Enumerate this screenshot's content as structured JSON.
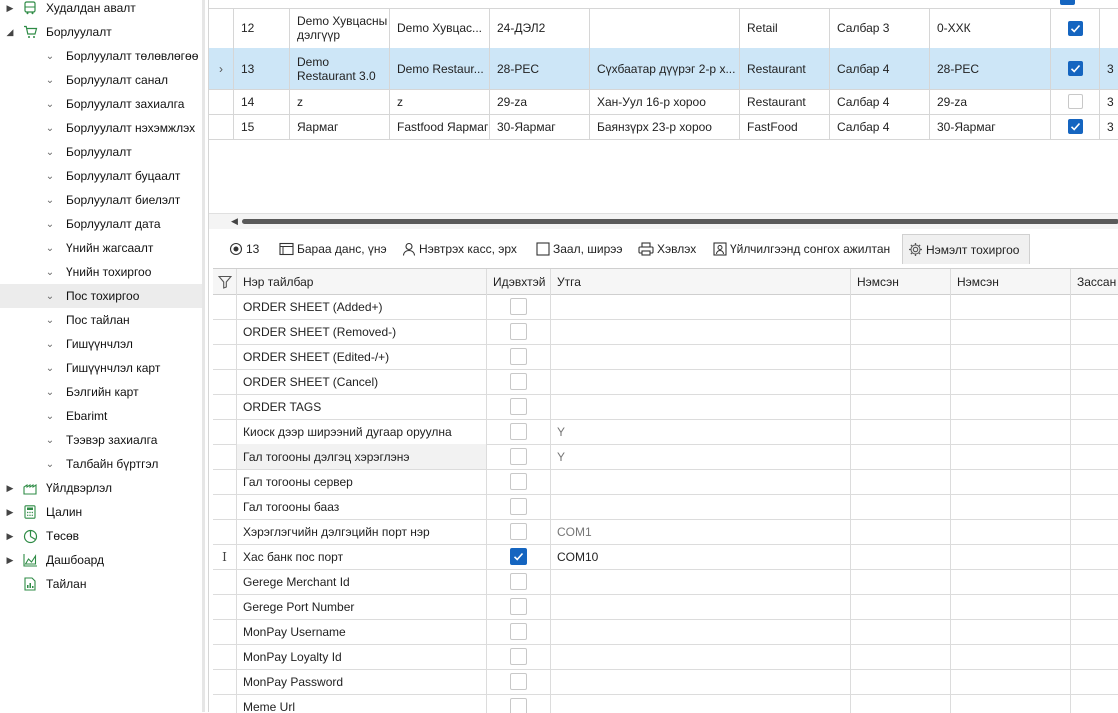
{
  "sidebar": {
    "items": [
      {
        "label": "Худалдан авалт",
        "level": 0,
        "expander": "▶",
        "icon": "bus-icon"
      },
      {
        "label": "Борлуулалт",
        "level": 0,
        "expander": "◢",
        "icon": "cart-icon"
      },
      {
        "label": "Борлуулалт төлөвлөгөө",
        "level": 1
      },
      {
        "label": "Борлуулалт санал",
        "level": 1
      },
      {
        "label": "Борлуулалт захиалга",
        "level": 1
      },
      {
        "label": "Борлуулалт нэхэмжлэх",
        "level": 1
      },
      {
        "label": "Борлуулалт",
        "level": 1
      },
      {
        "label": "Борлуулалт буцаалт",
        "level": 1
      },
      {
        "label": "Борлуулалт биелэлт",
        "level": 1
      },
      {
        "label": "Борлуулалт дата",
        "level": 1
      },
      {
        "label": "Үнийн жагсаалт",
        "level": 1
      },
      {
        "label": "Үнийн тохиргоо",
        "level": 1
      },
      {
        "label": "Пос тохиргоо",
        "level": 1,
        "selected": true
      },
      {
        "label": "Пос тайлан",
        "level": 1
      },
      {
        "label": "Гишүүнчлэл",
        "level": 1
      },
      {
        "label": "Гишүүнчлэл карт",
        "level": 1
      },
      {
        "label": "Бэлгийн карт",
        "level": 1
      },
      {
        "label": "Ebarimt",
        "level": 1
      },
      {
        "label": "Тээвэр захиалга",
        "level": 1
      },
      {
        "label": "Талбайн бүртгэл",
        "level": 1
      },
      {
        "label": "Үйлдвэрлэл",
        "level": 0,
        "expander": "▶",
        "icon": "factory-icon"
      },
      {
        "label": "Цалин",
        "level": 0,
        "expander": "▶",
        "icon": "calculator-icon"
      },
      {
        "label": "Төсөв",
        "level": 0,
        "expander": "▶",
        "icon": "pie-chart-icon"
      },
      {
        "label": "Дашбоард",
        "level": 0,
        "expander": "▶",
        "icon": "area-chart-icon"
      },
      {
        "label": "Тайлан",
        "level": 0,
        "expander": "",
        "icon": "report-icon"
      }
    ]
  },
  "top_grid": {
    "rows": [
      {
        "id": "12",
        "name": "Demo Хувцасны дэлгүүр",
        "short": "Demo Хувцас...",
        "code": "24-ДЭЛ2",
        "address": "",
        "type": "Retail",
        "branch": "Салбар 3",
        "code2": "0-ХХК",
        "active": true,
        "extra": "",
        "selected": false
      },
      {
        "id": "13",
        "name": "Demo Restaurant 3.0",
        "short": "Demo Restaur...",
        "code": "28-PEC",
        "address": "Сүхбаатар дүүрэг 2-р х...",
        "type": "Restaurant",
        "branch": "Салбар 4",
        "code2": "28-PEC",
        "active": true,
        "extra": "3",
        "selected": true
      },
      {
        "id": "14",
        "name": "z",
        "short": "z",
        "code": "29-za",
        "address": "Хан-Уул 16-р хороо",
        "type": "Restaurant",
        "branch": "Салбар 4",
        "code2": "29-za",
        "active": false,
        "extra": "3",
        "selected": false
      },
      {
        "id": "15",
        "name": "Яармаг",
        "short": "Fastfood Яармаг",
        "code": "30-Яармаг",
        "address": "Баянзүрх 23-р хороо",
        "type": "FastFood",
        "branch": "Салбар 4",
        "code2": "30-Яармаг",
        "active": true,
        "extra": "3",
        "selected": false
      }
    ],
    "row_indicator": "›"
  },
  "tabs": [
    {
      "label": "13",
      "icon": "radio-icon",
      "active": false
    },
    {
      "label": "Бараа данс, үнэ",
      "icon": "receipt-icon",
      "active": false
    },
    {
      "label": "Нэвтрэх касс, эрх",
      "icon": "user-icon",
      "active": false
    },
    {
      "label": "Заал, ширээ",
      "icon": "table-icon",
      "active": false
    },
    {
      "label": "Хэвлэх",
      "icon": "printer-icon",
      "active": false
    },
    {
      "label": "Үйлчилгээнд сонгох ажилтан",
      "icon": "staff-card-icon",
      "active": false
    },
    {
      "label": "Нэмэлт тохиргоо",
      "icon": "gear-icon",
      "active": true
    }
  ],
  "settings_grid": {
    "headers": {
      "name": "Нэр тайлбар",
      "active": "Идэвхтэй",
      "value": "Утга",
      "added1": "Нэмсэн",
      "added2": "Нэмсэн",
      "edited": "Зассан"
    },
    "rows": [
      {
        "name": "ORDER SHEET (Added+)",
        "active": false,
        "value": ""
      },
      {
        "name": "ORDER SHEET (Removed-)",
        "active": false,
        "value": ""
      },
      {
        "name": "ORDER SHEET (Edited-/+)",
        "active": false,
        "value": ""
      },
      {
        "name": "ORDER SHEET (Cancel)",
        "active": false,
        "value": ""
      },
      {
        "name": "ORDER TAGS",
        "active": false,
        "value": ""
      },
      {
        "name": "Киоск дээр ширээний дугаар оруулна",
        "active": false,
        "value": "Y"
      },
      {
        "name": "Гал тогооны дэлгэц хэрэглэнэ",
        "active": false,
        "value": "Y",
        "highlight": true
      },
      {
        "name": "Гал тогооны сервер",
        "active": false,
        "value": ""
      },
      {
        "name": "Гал тогооны бааз",
        "active": false,
        "value": ""
      },
      {
        "name": "Хэрэглэгчийн дэлгэцийн порт нэр",
        "active": false,
        "value": "COM1"
      },
      {
        "name": "Хас банк пос порт",
        "active": true,
        "value": "COM10",
        "cursor": true
      },
      {
        "name": "Gerege Merchant Id",
        "active": false,
        "value": ""
      },
      {
        "name": "Gerege Port Number",
        "active": false,
        "value": ""
      },
      {
        "name": "MonPay Username",
        "active": false,
        "value": ""
      },
      {
        "name": "MonPay Loyalty Id",
        "active": false,
        "value": ""
      },
      {
        "name": "MonPay Password",
        "active": false,
        "value": ""
      },
      {
        "name": "Meme Url",
        "active": false,
        "value": ""
      }
    ]
  },
  "colors": {
    "accent": "#1565c0",
    "selected_row": "#cde6f7",
    "icon_green": "#2e8b45"
  }
}
